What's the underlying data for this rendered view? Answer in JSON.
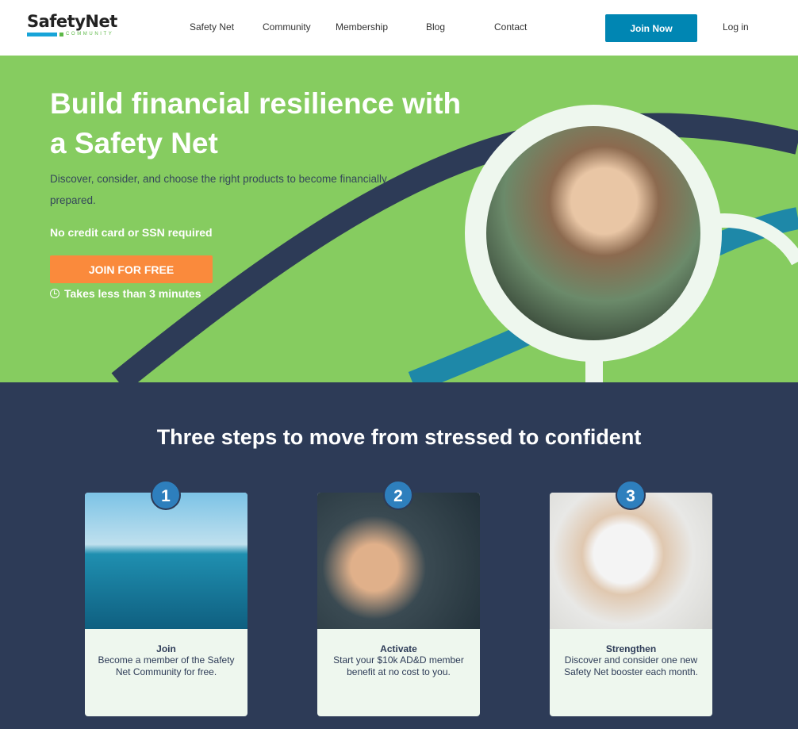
{
  "nav": {
    "logo": "SafetyNet",
    "logo_sub": "COMMUNITY",
    "links": [
      "Safety Net",
      "Community",
      "Membership",
      "Blog",
      "Contact"
    ],
    "join": "Join Now",
    "login": "Log in"
  },
  "hero": {
    "title": "Build financial resilience with a Safety Net",
    "description": "Discover, consider, and choose the right products to become financially prepared.",
    "note": "No credit card or SSN required",
    "cta": "JOIN FOR FREE",
    "time": "Takes less than 3 minutes"
  },
  "steps": {
    "title": "Three steps to move from stressed to confident",
    "cards": [
      {
        "num": "1",
        "title": "Join",
        "desc": "Become a member of the Safety Net Community for free."
      },
      {
        "num": "2",
        "title": "Activate",
        "desc": "Start your $10k AD&D member benefit at no cost to you."
      },
      {
        "num": "3",
        "title": "Strengthen",
        "desc": "Discover and consider one new Safety Net booster each month."
      }
    ]
  },
  "colors": {
    "green": "#86cc60",
    "navy": "#2d3b57",
    "accent": "#0086b3",
    "orange": "#fa8a3c"
  }
}
